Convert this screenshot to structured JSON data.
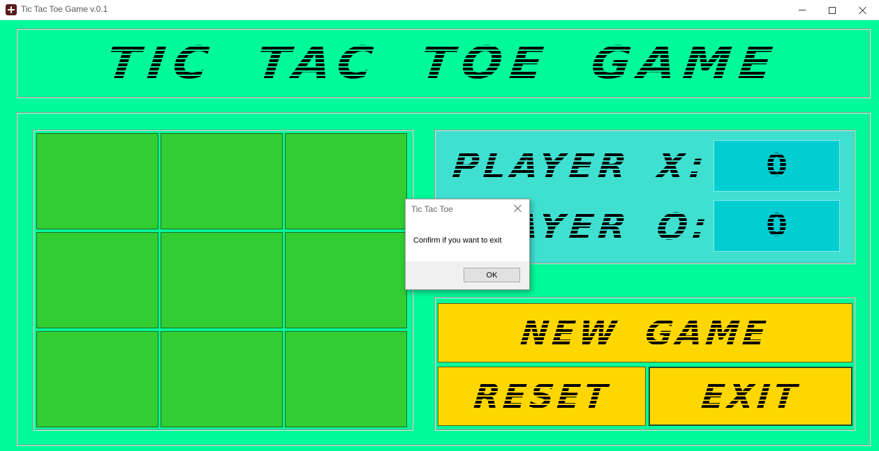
{
  "window": {
    "title": "Tic Tac Toe Game v.0.1",
    "controls": [
      "minimize-icon",
      "maximize-icon",
      "close-icon"
    ]
  },
  "header": {
    "title": "TIC TAC TOE GAME"
  },
  "board": {
    "cells": [
      "",
      "",
      "",
      "",
      "",
      "",
      "",
      "",
      ""
    ]
  },
  "scores": {
    "player_x_label": "PLAYER X:",
    "player_x_score": "0",
    "player_o_label": "PLAYER O:",
    "player_o_score": "0"
  },
  "buttons": {
    "new_game": "NEW GAME",
    "reset": "RESET",
    "exit": "EXIT"
  },
  "dialog": {
    "title": "Tic Tac Toe",
    "message": "Confirm if you want to exit",
    "ok_label": "OK"
  },
  "colors": {
    "background": "#00fa9a",
    "board_cell": "#32cd32",
    "score_panel": "#40e0d0",
    "score_box": "#00ced1",
    "button": "#ffd700"
  }
}
